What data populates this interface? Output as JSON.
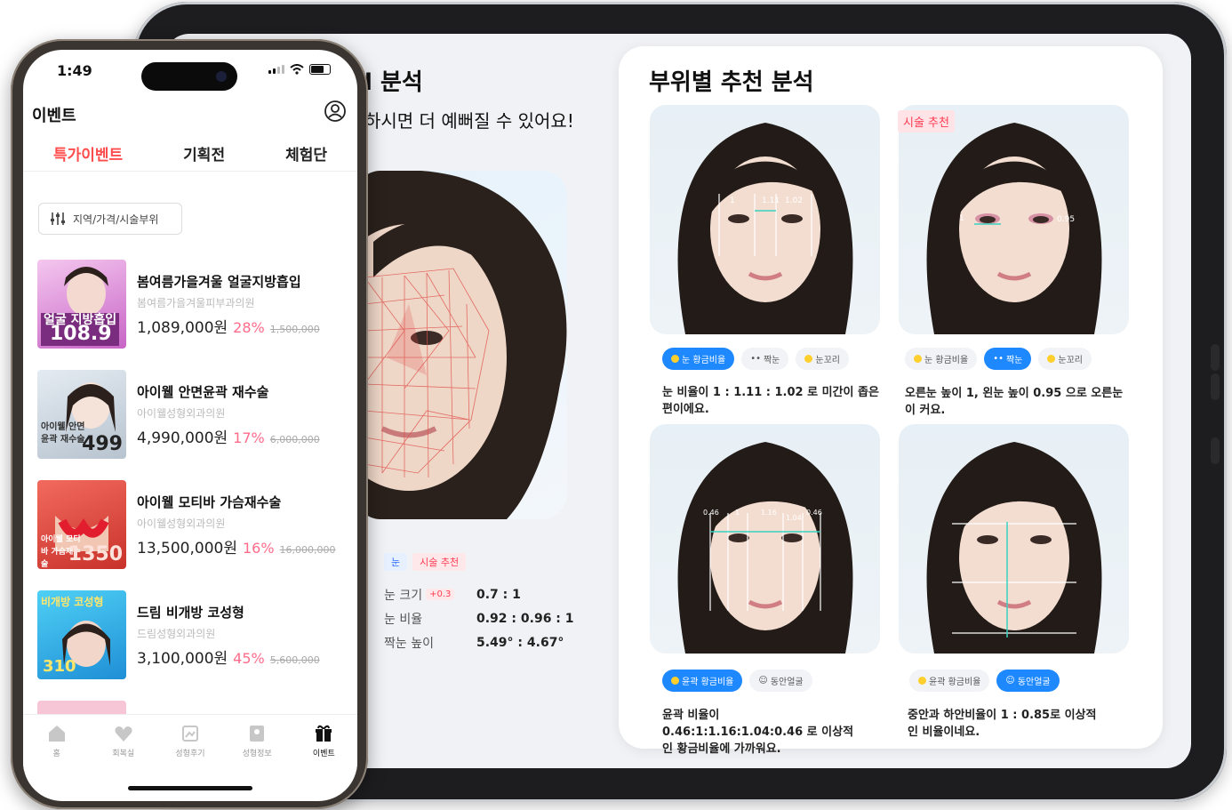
{
  "tablet": {
    "analysis": {
      "title": "l 분석",
      "subtitle": "하시면 더 예뻐질 수 있어요!",
      "tags": [
        "눈",
        "시술 추천"
      ],
      "metrics": [
        {
          "label": "눈 크기",
          "plus": "+0.3",
          "value": "0.7 : 1"
        },
        {
          "label": "눈 비율",
          "plus": "",
          "value": "0.92 : 0.96 : 1"
        },
        {
          "label": "짝눈 높이",
          "plus": "",
          "value": "5.49° : 4.67°"
        }
      ]
    },
    "recommend": {
      "title": "부위별 추천 분석",
      "badge": "시술 추천",
      "cards": [
        {
          "chips": [
            {
              "label": "눈 황금비율",
              "on": true
            },
            {
              "label": "짝눈",
              "on": false
            },
            {
              "label": "눈꼬리",
              "on": false
            }
          ],
          "desc": "눈 비율이 1 : 1.11 : 1.02 로 미간이 좁은 편이에요.",
          "overlay": [
            "1",
            "1.11",
            "1.02"
          ]
        },
        {
          "chips": [
            {
              "label": "눈 황금비율",
              "on": false
            },
            {
              "label": "짝눈",
              "on": true
            },
            {
              "label": "눈꼬리",
              "on": false
            }
          ],
          "desc": "오른눈 높이 1, 왼눈 높이 0.95 으로 오른눈이 커요.",
          "overlay": [
            "1",
            "0.95"
          ]
        },
        {
          "chips": [
            {
              "label": "윤곽 황금비율",
              "on": true
            },
            {
              "label": "동안얼굴",
              "on": false
            }
          ],
          "desc": "윤곽 비율이 0.46:1:1.16:1.04:0.46 로 이상적인 황금비율에 가까워요.",
          "overlay": [
            "0.46",
            "1",
            "1.16",
            "1.04",
            "0.46"
          ]
        },
        {
          "chips": [
            {
              "label": "윤곽 황금비율",
              "on": false
            },
            {
              "label": "동안얼굴",
              "on": true
            }
          ],
          "desc": "중안과 하안비율이 1 : 0.85로 이상적인 비율이네요.",
          "overlay": []
        }
      ]
    }
  },
  "phone": {
    "status": {
      "time": "1:49"
    },
    "app_title": "이벤트",
    "tabs": [
      "특가이벤트",
      "기획전",
      "체험단"
    ],
    "filter_label": "지역/가격/시술부위",
    "events": [
      {
        "title": "봄여름가을겨울 얼굴지방흡입",
        "clinic": "봄여름가을겨울피부과의원",
        "price": "1,089,000원",
        "discount": "28%",
        "original": "1,500,000",
        "thumb_text": "얼굴 지방흡입",
        "thumb_big": "108.9",
        "thumb_color": "#d98ad6"
      },
      {
        "title": "아이웰 안면윤곽 재수술",
        "clinic": "아이웰성형외과의원",
        "price": "4,990,000원",
        "discount": "17%",
        "original": "6,000,000",
        "thumb_text": "아이웰 안면윤곽 재수술",
        "thumb_big": "499",
        "thumb_color": "#c9d3dc"
      },
      {
        "title": "아이웰 모티바 가슴재수술",
        "clinic": "아이웰성형외과의원",
        "price": "13,500,000원",
        "discount": "16%",
        "original": "16,000,000",
        "thumb_text": "아이웰 모티바 가슴재수술",
        "thumb_big": "1350",
        "thumb_color": "#e8473a"
      },
      {
        "title": "드림 비개방 코성형",
        "clinic": "드림성형외과의원",
        "price": "3,100,000원",
        "discount": "45%",
        "original": "5,600,000",
        "thumb_text": "비개방 코성형",
        "thumb_big": "310",
        "thumb_color": "#2fb7e8"
      }
    ],
    "nav": [
      {
        "label": "홈",
        "icon": "home-icon",
        "active": false
      },
      {
        "label": "회복실",
        "icon": "heart-icon",
        "active": false
      },
      {
        "label": "성형후기",
        "icon": "review-icon",
        "active": false
      },
      {
        "label": "성형정보",
        "icon": "info-icon",
        "active": false
      },
      {
        "label": "이벤트",
        "icon": "gift-icon",
        "active": true
      }
    ]
  }
}
